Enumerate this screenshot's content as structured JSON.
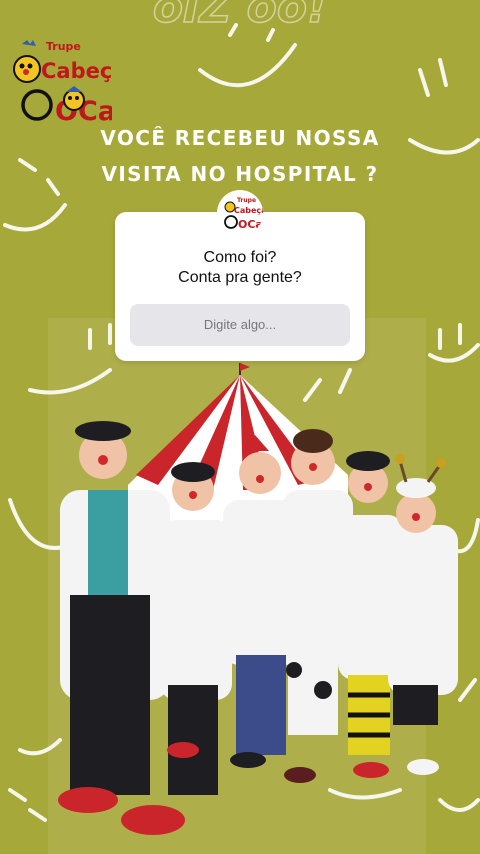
{
  "logo": {
    "line1": "Trupe",
    "line2": "Cabeça",
    "line3": "OCa"
  },
  "headline": {
    "line1": "VOCÊ RECEBEU NOSSA",
    "line2": "VISITA NO HOSPITAL ?"
  },
  "question_box": {
    "prompt_line1": "Como foi?",
    "prompt_line2": "Conta pra gente?",
    "input_placeholder": "Digite algo..."
  },
  "colors": {
    "background": "#a6a83a",
    "headline": "#ffffff",
    "logo_text": "#c0171d"
  },
  "photo": {
    "description": "group-of-hospital-clowns",
    "people_count": 7
  }
}
